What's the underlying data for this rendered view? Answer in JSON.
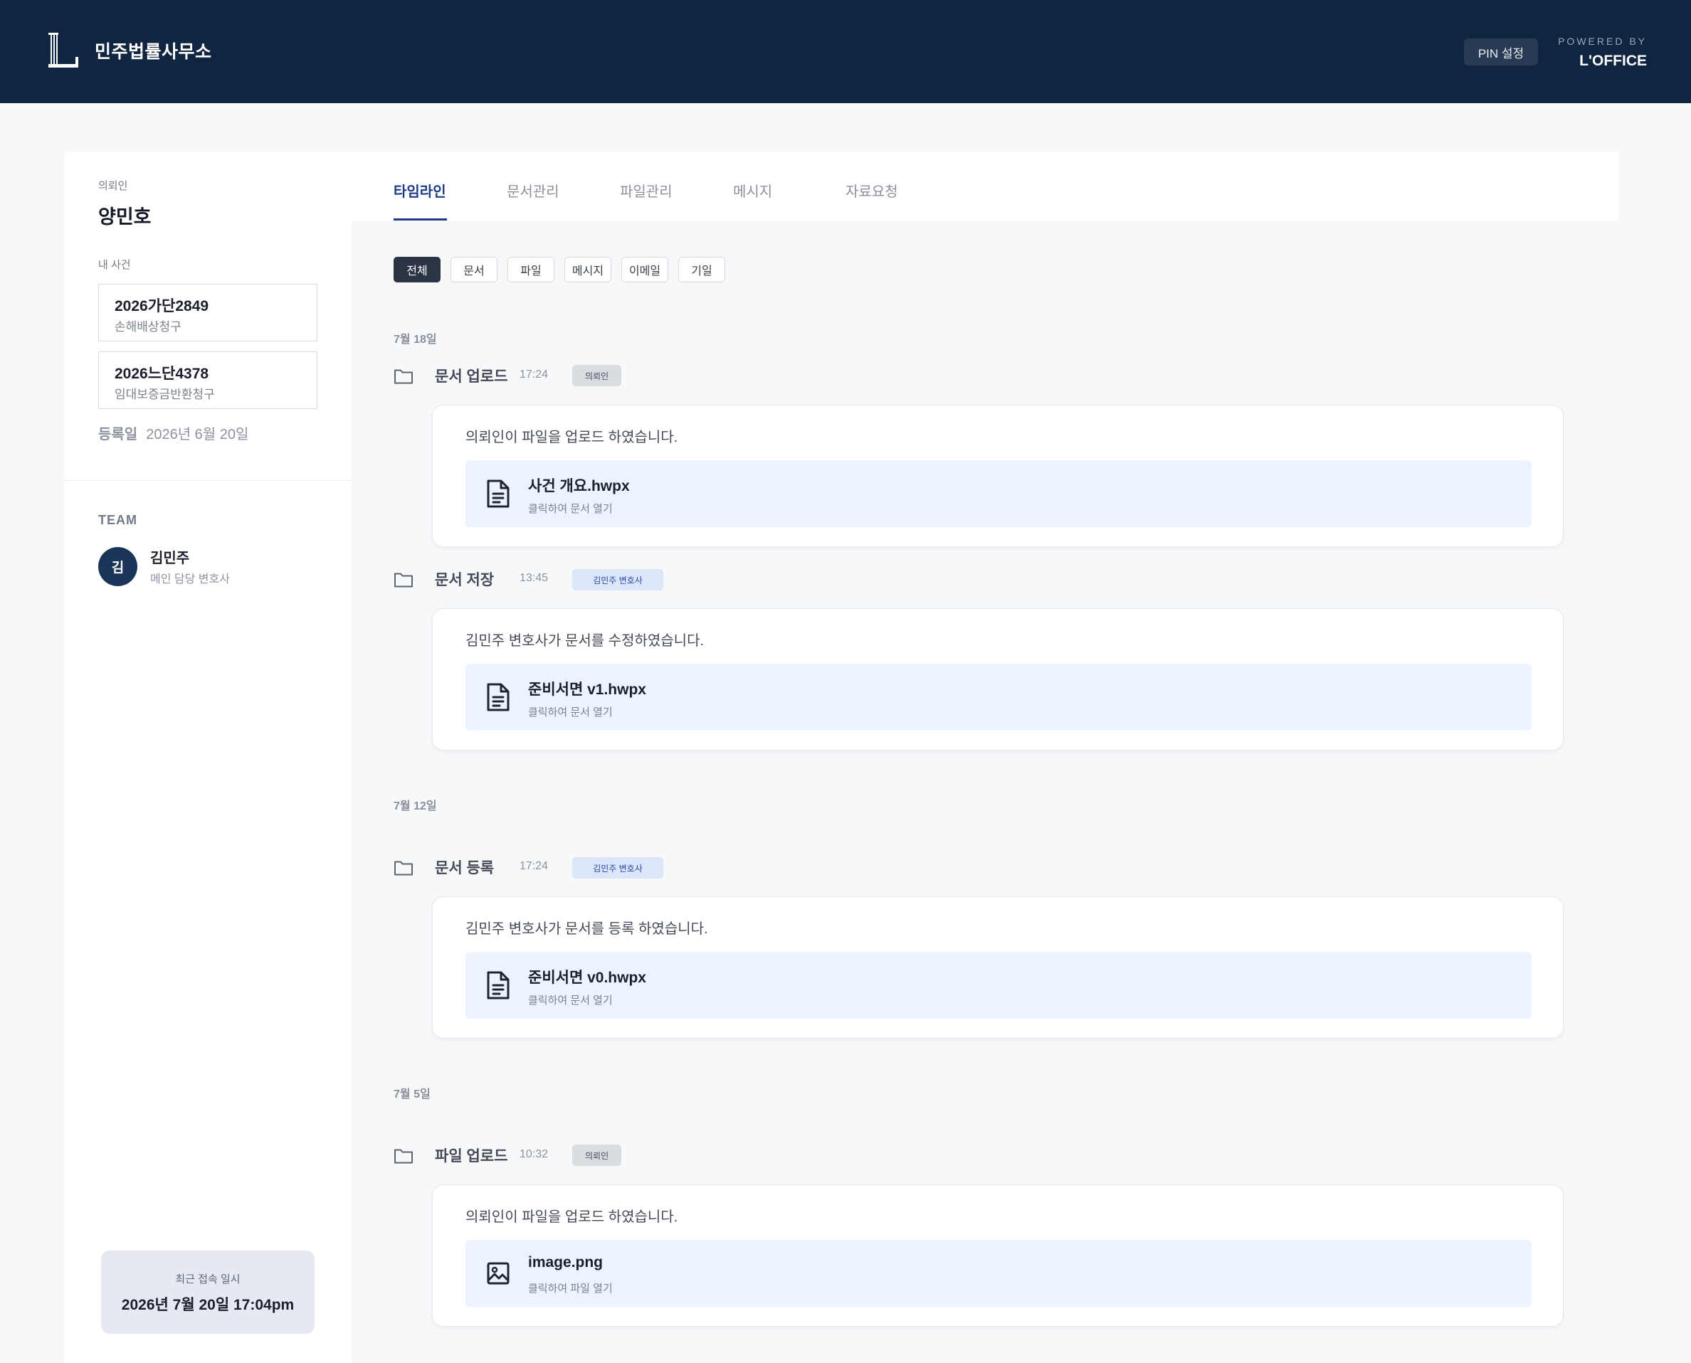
{
  "header": {
    "firm_name": "민주법률사무소",
    "pin_button": "PIN 설정",
    "powered_by": "POWERED BY",
    "brand": "L'OFFICE"
  },
  "sidebar": {
    "client_label": "의뢰인",
    "client_name": "양민호",
    "cases_label": "내 사건",
    "cases": [
      {
        "number": "2026가단2849",
        "type": "손해배상청구"
      },
      {
        "number": "2026느단4378",
        "type": "임대보증금반환청구"
      }
    ],
    "registered_label": "등록일",
    "registered_date": "2026년 6월 20일",
    "team_label": "TEAM",
    "team": [
      {
        "initial": "김",
        "name": "김민주",
        "role": "메인 담당 변호사"
      }
    ],
    "recent_access_label": "최근 접속 일시",
    "recent_access_value": "2026년 7월 20일 17:04pm"
  },
  "tabs": [
    "타임라인",
    "문서관리",
    "파일관리",
    "메시지",
    "자료요청"
  ],
  "active_tab": "타임라인",
  "filters": [
    "전체",
    "문서",
    "파일",
    "메시지",
    "이메일",
    "기일"
  ],
  "active_filter": "전체",
  "timeline": {
    "dates": [
      "7월 18일",
      "7월 12일",
      "7월 5일"
    ],
    "events": [
      {
        "title": "문서 업로드",
        "time": "17:24",
        "badge": "의뢰인",
        "badge_type": "client",
        "message": "의뢰인이 파일을 업로드 하였습니다.",
        "file_name": "사건 개요.hwpx",
        "file_action": "클릭하여 문서 열기",
        "file_icon": "document-icon"
      },
      {
        "title": "문서 저장",
        "time": "13:45",
        "badge": "김민주 변호사",
        "badge_type": "lawyer",
        "message": "김민주 변호사가 문서를 수정하였습니다.",
        "file_name": "준비서면 v1.hwpx",
        "file_action": "클릭하여 문서 열기",
        "file_icon": "document-icon"
      },
      {
        "title": "문서 등록",
        "time": "17:24",
        "badge": "김민주 변호사",
        "badge_type": "lawyer",
        "message": "김민주 변호사가 문서를 등록 하였습니다.",
        "file_name": "준비서면 v0.hwpx",
        "file_action": "클릭하여 문서 열기",
        "file_icon": "document-icon"
      },
      {
        "title": "파일 업로드",
        "time": "10:32",
        "badge": "의뢰인",
        "badge_type": "client",
        "message": "의뢰인이 파일을 업로드 하였습니다.",
        "file_name": "image.png",
        "file_action": "클릭하여 파일 열기",
        "file_icon": "image-icon"
      }
    ]
  },
  "colors": {
    "header_bg": "#102540",
    "accent": "#1f3a88",
    "file_bg": "#eef4ff",
    "lawyer_badge_bg": "#dce6fb",
    "client_badge_bg": "#d9dce1"
  }
}
